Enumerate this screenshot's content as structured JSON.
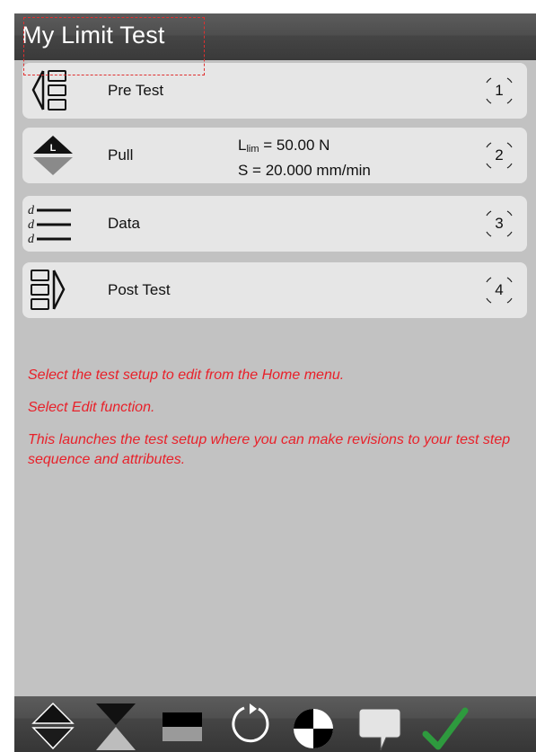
{
  "window": {
    "title": "My Limit Test"
  },
  "steps": [
    {
      "label": "Pre Test",
      "number": "1",
      "icon": "pre-test-icon"
    },
    {
      "label": "Pull",
      "number": "2",
      "icon": "pull-icon",
      "detail": {
        "limit_symbol": "L",
        "limit_sub": "lim",
        "limit_value": " = 50.00 N",
        "speed": "S = 20.000 mm/min"
      },
      "badge": "L"
    },
    {
      "label": "Data",
      "number": "3",
      "icon": "data-icon",
      "glyph": "d"
    },
    {
      "label": "Post Test",
      "number": "4",
      "icon": "post-test-icon"
    }
  ],
  "instructions": [
    "Select the test setup to edit from the Home menu.",
    "Select Edit function.",
    "This launches the test setup where you can make revisions to your test step sequence and attributes."
  ],
  "toolbar": {
    "items": [
      "move-up-down-icon",
      "hourglass-icon",
      "half-rectangle-icon",
      "loop-icon",
      "checkered-circle-icon",
      "comment-bubble-icon",
      "checkmark-icon"
    ]
  },
  "colors": {
    "instruction_text": "#e8212a",
    "checkmark": "#2e9a3e",
    "panel": "#c2c2c2",
    "step_bg": "#e6e6e6"
  }
}
